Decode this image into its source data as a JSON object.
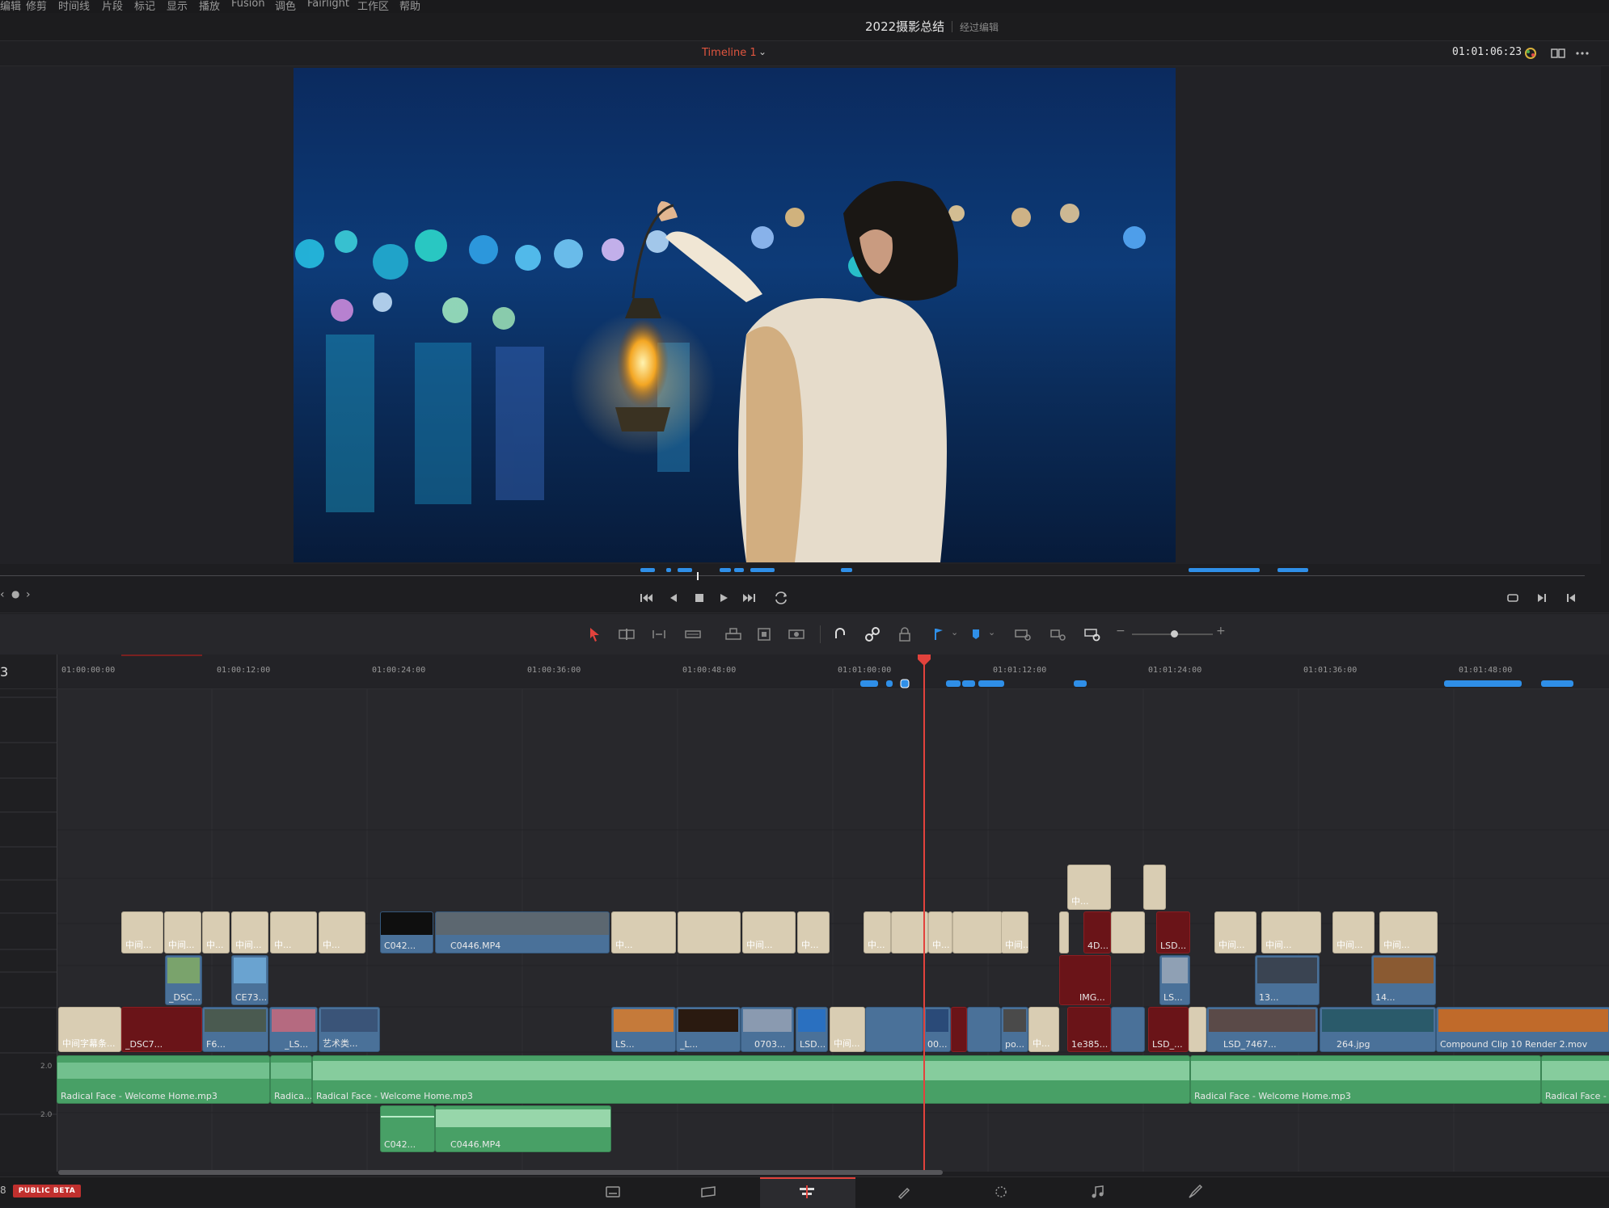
{
  "menu": {
    "items": [
      "编辑",
      "修剪",
      "时间线",
      "片段",
      "标记",
      "显示",
      "播放",
      "Fusion",
      "调色",
      "Fairlight",
      "工作区",
      "帮助"
    ]
  },
  "project": {
    "title": "2022摄影总结",
    "status": "经过编辑"
  },
  "viewer": {
    "timeline_name": "Timeline 1",
    "timecode": "01:01:06:23"
  },
  "ruler": {
    "track_number": "3",
    "ticks": [
      "01:00:00:00",
      "01:00:12:00",
      "01:00:24:00",
      "01:00:36:00",
      "01:00:48:00",
      "01:01:00:00",
      "01:01:12:00",
      "01:01:24:00",
      "01:01:36:00",
      "01:01:48:00"
    ]
  },
  "clips": {
    "v3_a": "中...",
    "v3_b": "中...",
    "v2_a": "中间...",
    "v2_b": "中间...",
    "v2_c": "中...",
    "v2_d": "中间...",
    "v2_e": "中...",
    "v2_f": "中...",
    "v2_c042": "C042...",
    "v2_c0446": "C0446.MP4",
    "v2_g": "中...",
    "v2_h": "中间...",
    "v2_i": "中...",
    "v2_j": "中...",
    "v2_k": "中...",
    "v2_4d": "4D...",
    "v2_lsd": "LSD...",
    "v2_l": "中间...",
    "v2_m": "中间...",
    "v2_n": "中间...",
    "v2_o": "中间...",
    "v15_dsc": "_DSC...",
    "v15_ce73": "CE73...",
    "v15_img": "IMG...",
    "v15_ls": "LS...",
    "v15_13": "13...",
    "v15_14": "14...",
    "v1_a": "中间字幕条...",
    "v1_dsc7": "_DSC7...",
    "v1_f6": "F6...",
    "v1_ls": "_LS...",
    "v1_art": "艺术类...",
    "v1_ls2": "LS...",
    "v1_l": "_L...",
    "v1_0703": "0703...",
    "v1_lsd": "LSD...",
    "v1_mid": "中间...",
    "v1_00": "00...",
    "v1_po": "po...",
    "v1_zh": "中...",
    "v1_1e385": "1e385...",
    "v1_lsd2": "LSD_...",
    "v1_lsd7467": "LSD_7467...",
    "v1_264": "264.jpg",
    "v1_compound": "Compound Clip 10 Render 2.mov",
    "a1_label": "2.0",
    "a1_a": "Radical Face - Welcome Home.mp3",
    "a1_b": "Radica...",
    "a1_c": "Radical Face - Welcome Home.mp3",
    "a1_d": "Radical Face - Welcome Home.mp3",
    "a1_e": "Radical Face - W",
    "a2_label": "2.0",
    "a2_a": "C042...",
    "a2_b": "C0446.MP4"
  },
  "footer": {
    "version": "8",
    "beta_badge": "PUBLIC BETA"
  },
  "colors": {
    "accent_red": "#e2423c",
    "clip_blue": "#4a7199",
    "clip_beige": "#d9cdb3",
    "clip_red": "#6a1418",
    "audio_green": "#48a066",
    "marker_blue": "#2f8fe8"
  },
  "icons": [
    "selection-arrow-icon",
    "trim-icon",
    "dynamic-trim-icon",
    "blade-icon",
    "insert-icon",
    "overwrite-icon",
    "replace-icon",
    "snap-icon",
    "link-icon",
    "lock-icon",
    "flag-icon",
    "marker-icon",
    "zoom-full-icon",
    "zoom-detail-icon",
    "zoom-custom-icon",
    "zoom-out-icon",
    "zoom-in-icon",
    "media-page-icon",
    "cut-page-icon",
    "edit-page-icon",
    "fusion-page-icon",
    "color-page-icon",
    "fairlight-page-icon",
    "deliver-page-icon"
  ]
}
